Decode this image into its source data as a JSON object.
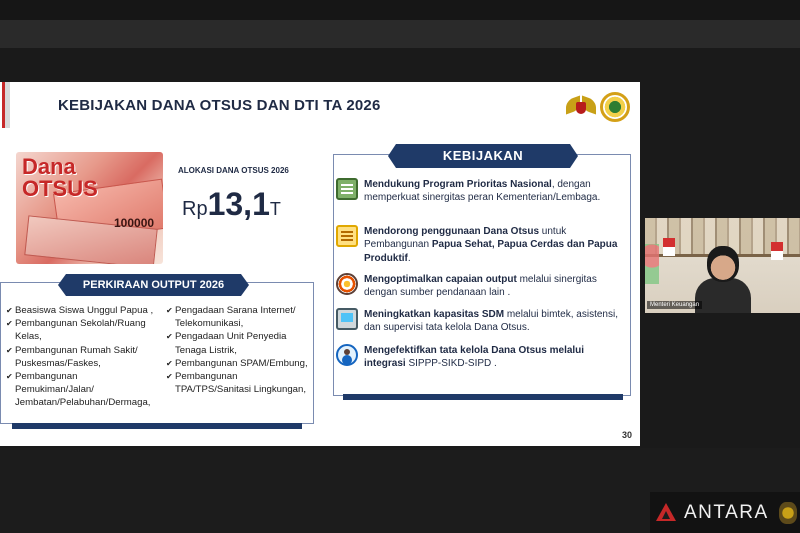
{
  "slide": {
    "title": "KEBIJAKAN DANA OTSUS DAN DTI TA 2026",
    "page_number": "30",
    "image_label": {
      "line1": "Dana",
      "line2": "OTSUS",
      "note_value": "100000"
    },
    "allocation": {
      "label": "ALOKASI DANA OTSUS 2026",
      "currency": "Rp",
      "value": "13,1",
      "unit": "T"
    },
    "output": {
      "header": "PERKIRAAN OUTPUT 2026",
      "left_items": [
        "Beasiswa Siswa Unggul Papua ,",
        "Pembangunan Sekolah/Ruang Kelas,",
        "Pembangunan Rumah Sakit/ Puskesmas/Faskes,",
        "Pembangunan Pemukiman/Jalan/ Jembatan/Pelabuhan/Dermaga,"
      ],
      "right_items": [
        "Pengadaan Sarana Internet/ Telekomunikasi,",
        "Pengadaan Unit Penyedia Tenaga Listrik,",
        "Pembangunan SPAM/Embung,",
        "Pembangunan TPA/TPS/Sanitasi Lingkungan,"
      ],
      "check_glyph": "✔"
    },
    "kebijakan": {
      "header": "KEBIJAKAN",
      "items": [
        {
          "icon": "book-icon",
          "bold1": "Mendukung Program Prioritas Nasional",
          "rest": ", dengan memperkuat sinergitas peran Kementerian/Lembaga."
        },
        {
          "icon": "document-icon",
          "bold1": "Mendorong penggunaan Dana Otsus",
          "mid": " untuk Pembangunan ",
          "bold2": "Papua Sehat, Papua Cerdas dan Papua Produktif",
          "rest": "."
        },
        {
          "icon": "target-icon",
          "bold1": "Mengoptimalkan capaian output",
          "rest": " melalui sinergitas dengan sumber pendanaan lain ."
        },
        {
          "icon": "laptop-icon",
          "bold1": "Meningkatkan kapasitas SDM",
          "rest": " melalui bimtek, asistensi, dan supervisi tata kelola Dana Otsus."
        },
        {
          "icon": "person-icon",
          "bold1": "Mengefektifkan tata kelola Dana Otsus melalui integrasi",
          "rest": " SIPPP-SIKD-SIPD ."
        }
      ]
    }
  },
  "video": {
    "name_tag": "Menteri Keuangan"
  },
  "watermark": {
    "text": "ANTARA"
  },
  "colors": {
    "navy": "#1f3a68",
    "red": "#c62828",
    "text": "#1f2a44"
  }
}
